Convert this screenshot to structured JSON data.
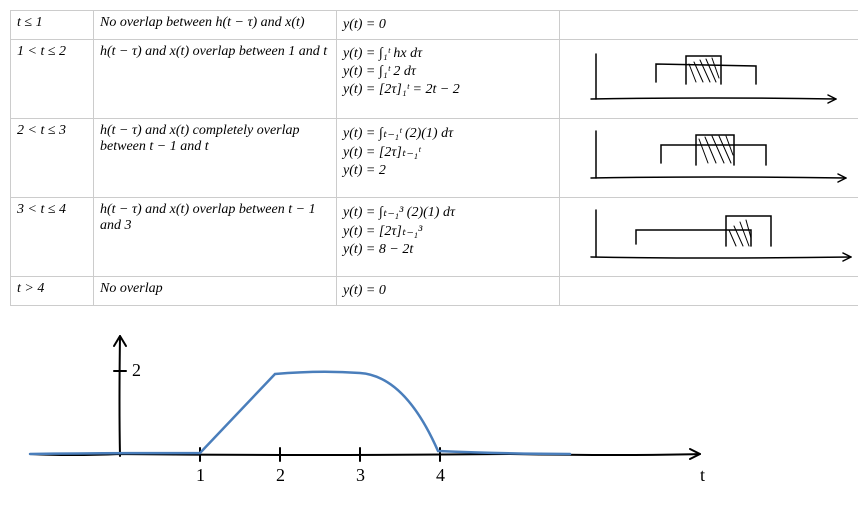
{
  "table": {
    "rows": [
      {
        "cond": "t ≤ 1",
        "desc": "No overlap between h(t − τ) and x(t)",
        "eq": [
          "y(t) = 0"
        ],
        "sketch": null
      },
      {
        "cond": "1 < t ≤ 2",
        "desc": "h(t − τ) and x(t) overlap between 1 and t",
        "eq": [
          "y(t) = ∫₁ᵗ hx dτ",
          "y(t) = ∫₁ᵗ 2 dτ",
          "y(t) = [2τ]₁ᵗ = 2t − 2"
        ],
        "sketch": "row2"
      },
      {
        "cond": "2 < t ≤ 3",
        "desc": "h(t − τ) and x(t) completely overlap between t − 1 and t",
        "eq": [
          "y(t) = ∫ₜ₋₁ᵗ (2)(1) dτ",
          "y(t) = [2τ]ₜ₋₁ᵗ",
          "y(t) = 2"
        ],
        "sketch": "row3"
      },
      {
        "cond": "3 < t ≤ 4",
        "desc": "h(t − τ) and x(t) overlap between t − 1 and 3",
        "eq": [
          "y(t) = ∫ₜ₋₁³ (2)(1) dτ",
          "y(t) = [2τ]ₜ₋₁³",
          "y(t) = 8 − 2t"
        ],
        "sketch": "row4"
      },
      {
        "cond": "t > 4",
        "desc": "No overlap",
        "eq": [
          "y(t) = 0"
        ],
        "sketch": null
      }
    ]
  },
  "chart_data": {
    "type": "line",
    "title": "",
    "xlabel": "t",
    "ylabel": "",
    "y_tick_label": "2",
    "x_ticks": [
      "1",
      "2",
      "3",
      "4"
    ],
    "x": [
      0,
      1,
      2,
      3,
      4,
      5
    ],
    "y": [
      0,
      0,
      2,
      2,
      0,
      0
    ],
    "ylim": [
      0,
      2.5
    ]
  }
}
